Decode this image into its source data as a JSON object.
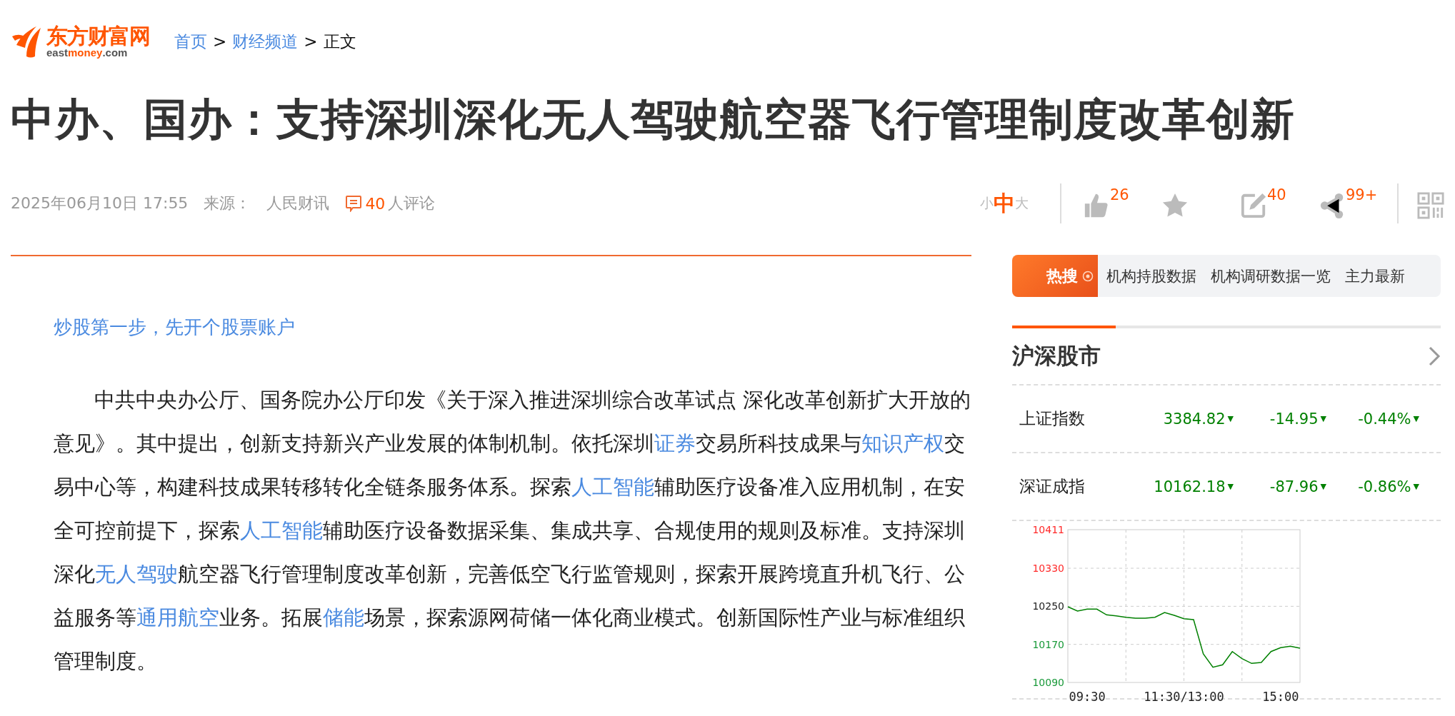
{
  "header": {
    "logo": {
      "name": "东方财富网",
      "domain": "east**money**.com"
    },
    "breadcrumb": [
      {
        "kind": "link",
        "label": "首页"
      },
      {
        "kind": "separator",
        "label": ">"
      },
      {
        "kind": "link",
        "label": "财经频道"
      },
      {
        "kind": "separator",
        "label": ">"
      },
      {
        "kind": "current",
        "label": "正文"
      }
    ]
  },
  "article": {
    "title": "中办、国办：支持深圳深化无人驾驶航空器飞行管理制度改革创新",
    "meta": {
      "date": "2025年06月10日 17:55",
      "source_label": "来源：",
      "source": "人民财讯",
      "comment_count": "40",
      "comment_suffix": "人评论"
    },
    "font_sizes": [
      {
        "label": "小",
        "selected": false
      },
      {
        "label": "中",
        "selected": true
      },
      {
        "label": "大",
        "selected": false
      }
    ],
    "actions": [
      {
        "kind": "like",
        "count": "26"
      },
      {
        "kind": "favorite"
      },
      {
        "kind": "edit",
        "count": "40"
      },
      {
        "kind": "share",
        "count": "99+"
      },
      {
        "kind": "qr"
      }
    ],
    "promo_link": "炒股第一步，先开个股票账户",
    "paragraph": [
      {
        "kind": "text",
        "text": "中共中央办公厅、国务院办公厅印发《关于深入推进深圳综合改革试点 深化改革创新扩大开放的意见》。其中提出，创新支持新兴产业发展的体制机制。依托深圳"
      },
      {
        "kind": "link",
        "text": "证券"
      },
      {
        "kind": "text",
        "text": "交易所科技成果与"
      },
      {
        "kind": "link",
        "text": "知识产权"
      },
      {
        "kind": "text",
        "text": "交易中心等，构建科技成果转移转化全链条服务体系。探索"
      },
      {
        "kind": "link",
        "text": "人工智能"
      },
      {
        "kind": "text",
        "text": "辅助医疗设备准入应用机制，在安全可控前提下，探索"
      },
      {
        "kind": "link",
        "text": "人工智能"
      },
      {
        "kind": "text",
        "text": "辅助医疗设备数据采集、集成共享、合规使用的规则及标准。支持深圳深化"
      },
      {
        "kind": "link",
        "text": "无人驾驶"
      },
      {
        "kind": "text",
        "text": "航空器飞行管理制度改革创新，完善低空飞行监管规则，探索开展跨境直升机飞行、公益服务等"
      },
      {
        "kind": "link",
        "text": "通用航空"
      },
      {
        "kind": "text",
        "text": "业务。拓展"
      },
      {
        "kind": "link",
        "text": "储能"
      },
      {
        "kind": "text",
        "text": "场景，探索源网荷储一体化商业模式。创新国际性产业与标准组织管理制度。"
      }
    ]
  },
  "sidebar": {
    "hot_search": {
      "label": "热搜",
      "items": [
        "机构持股数据",
        "机构调研数据一览",
        "主力最新"
      ]
    },
    "market": {
      "title": "沪深股市",
      "rows": [
        {
          "name": "上证指数",
          "price": "3384.82",
          "price_arrow": "▼",
          "change": "-14.95",
          "change_arrow": "▼",
          "percent": "-0.44%",
          "percent_arrow": "▼"
        },
        {
          "name": "深证成指",
          "price": "10162.18",
          "price_arrow": "▼",
          "change": "-87.96",
          "change_arrow": "▼",
          "percent": "-0.86%",
          "percent_arrow": "▼"
        }
      ],
      "chart_data": {
        "type": "line",
        "categories": [
          null,
          null,
          "09:30",
          null,
          null,
          null,
          null,
          null,
          null,
          null,
          null,
          null,
          "11:30/13:00",
          null,
          null,
          null,
          null,
          null,
          null,
          null,
          null,
          null,
          "15:00",
          null,
          null
        ],
        "series": [
          {
            "color": "#008000",
            "values": [
              10249,
              10240,
              10244,
              10244,
              10232,
              10230,
              10227,
              10225,
              10225,
              10227,
              10237,
              10231,
              10224,
              10222,
              10150,
              10122,
              10127,
              10155,
              10140,
              10130,
              10132,
              10155,
              10163,
              10166,
              10162
            ]
          }
        ],
        "ylim": [
          10090,
          10411
        ],
        "grid": true,
        "yticks": [
          10090,
          10170,
          10250,
          10330,
          10411
        ]
      }
    }
  }
}
